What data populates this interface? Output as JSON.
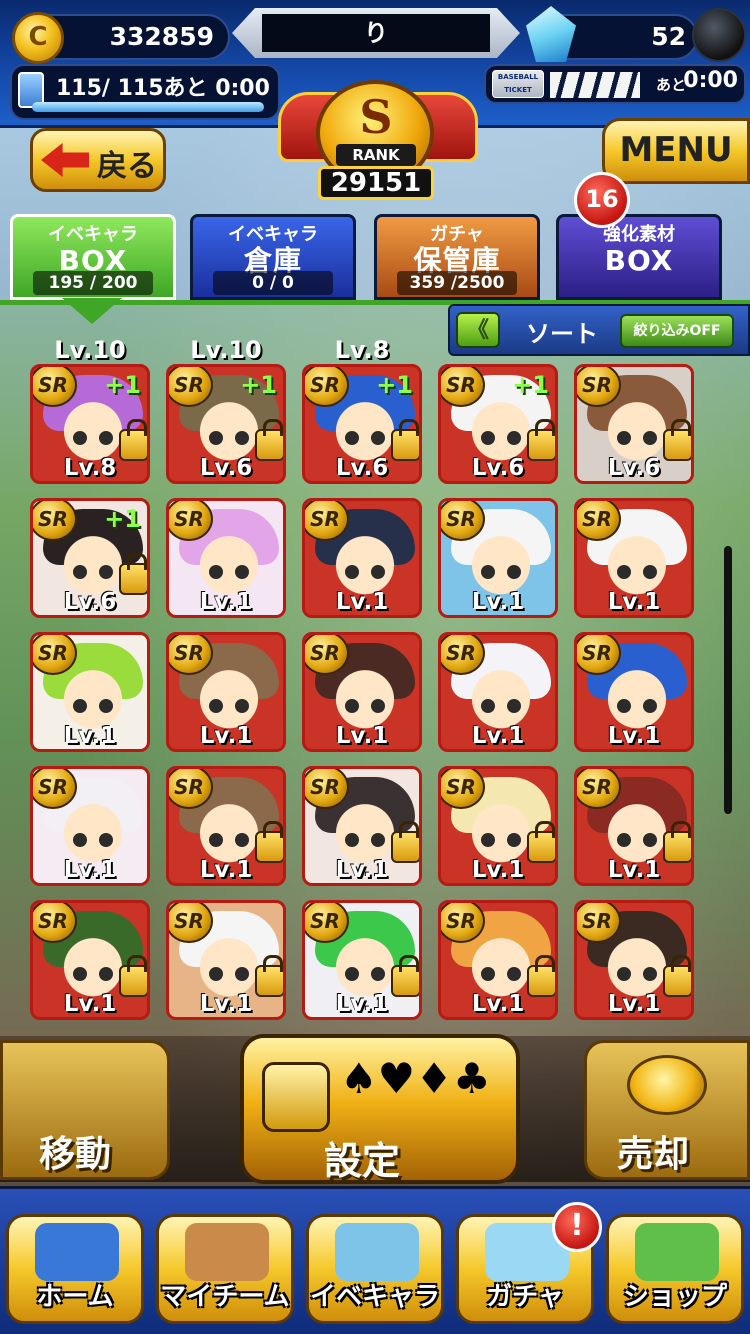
{
  "status": {
    "coins": "332859",
    "coin_icon": "C",
    "player_name": "り",
    "gems": "52",
    "stamina_text": "115/ 115あと  0:00",
    "ticket_label": "BASEBALL TICKET",
    "ticket_ato": "あと",
    "ticket_time": "0:00"
  },
  "rank": {
    "letter": "S",
    "label": "RANK",
    "points": "29151"
  },
  "nav_top": {
    "back_label": "戻る",
    "menu_label": "MENU"
  },
  "tabs": [
    {
      "top": "イベキャラ",
      "big": "BOX",
      "count": "195 / 200"
    },
    {
      "top": "イベキャラ",
      "big": "倉庫",
      "count": "0  /  0"
    },
    {
      "top": "ガチャ",
      "big": "保管庫",
      "count": "359 /2500"
    },
    {
      "top": "強化素材",
      "big": "BOX",
      "count": ""
    }
  ],
  "tab_badge": "16",
  "sort": {
    "arrows": "《",
    "label": "ソート",
    "filter": "絞り込みOFF"
  },
  "partial_row": [
    "Lv.10",
    "Lv.10",
    "Lv.8"
  ],
  "cards": [
    {
      "level": "Lv.8",
      "plus": "+1",
      "locked": true,
      "hair": "#b66ad8",
      "bg": "#c93426"
    },
    {
      "level": "Lv.6",
      "plus": "+1",
      "locked": true,
      "hair": "#7a6a4a",
      "bg": "#c93426"
    },
    {
      "level": "Lv.6",
      "plus": "+1",
      "locked": true,
      "hair": "#2a5fd0",
      "bg": "#c93426"
    },
    {
      "level": "Lv.6",
      "plus": "+1",
      "locked": true,
      "hair": "#f4f4f4",
      "bg": "#c93426"
    },
    {
      "level": "Lv.6",
      "plus": "",
      "locked": true,
      "hair": "#8a5a3c",
      "bg": "#d8d0c8"
    },
    {
      "level": "Lv.6",
      "plus": "+1",
      "locked": true,
      "hair": "#2a2222",
      "bg": "#f2e6e0"
    },
    {
      "level": "Lv.1",
      "plus": "",
      "locked": false,
      "hair": "#e2a6e8",
      "bg": "#f4e6f2"
    },
    {
      "level": "Lv.1",
      "plus": "",
      "locked": false,
      "hair": "#27304a",
      "bg": "#c93426"
    },
    {
      "level": "Lv.1",
      "plus": "",
      "locked": false,
      "hair": "#f5f5f5",
      "bg": "#7ec4e8"
    },
    {
      "level": "Lv.1",
      "plus": "",
      "locked": false,
      "hair": "#f5f5f5",
      "bg": "#c93426"
    },
    {
      "level": "Lv.1",
      "plus": "",
      "locked": false,
      "hair": "#9adc3c",
      "bg": "#f4f0e8"
    },
    {
      "level": "Lv.1",
      "plus": "",
      "locked": false,
      "hair": "#8a6a4a",
      "bg": "#c93426"
    },
    {
      "level": "Lv.1",
      "plus": "",
      "locked": false,
      "hair": "#4a2a22",
      "bg": "#c93426"
    },
    {
      "level": "Lv.1",
      "plus": "",
      "locked": false,
      "hair": "#f4f4f8",
      "bg": "#c93426"
    },
    {
      "level": "Lv.1",
      "plus": "",
      "locked": false,
      "hair": "#2a5fd0",
      "bg": "#c93426"
    },
    {
      "level": "Lv.1",
      "plus": "",
      "locked": false,
      "hair": "#f2f0f4",
      "bg": "#f4ecf2"
    },
    {
      "level": "Lv.1",
      "plus": "",
      "locked": true,
      "hair": "#8a6a4a",
      "bg": "#c93426"
    },
    {
      "level": "Lv.1",
      "plus": "",
      "locked": true,
      "hair": "#3a3232",
      "bg": "#f2e6e0"
    },
    {
      "level": "Lv.1",
      "plus": "",
      "locked": true,
      "hair": "#f4e8b0",
      "bg": "#c93426"
    },
    {
      "level": "Lv.1",
      "plus": "",
      "locked": true,
      "hair": "#8a2a22",
      "bg": "#c93426"
    },
    {
      "level": "Lv.1",
      "plus": "",
      "locked": true,
      "hair": "#3a6a2a",
      "bg": "#c93426"
    },
    {
      "level": "Lv.1",
      "plus": "",
      "locked": true,
      "hair": "#f5f5f5",
      "bg": "#e6b486"
    },
    {
      "level": "Lv.1",
      "plus": "",
      "locked": true,
      "hair": "#3cc84a",
      "bg": "#f0f0f4"
    },
    {
      "level": "Lv.1",
      "plus": "",
      "locked": true,
      "hair": "#f0a444",
      "bg": "#c93426"
    },
    {
      "level": "Lv.1",
      "plus": "",
      "locked": true,
      "hair": "#3a2a22",
      "bg": "#c93426"
    }
  ],
  "card_rarity": "SR",
  "actions": {
    "move": "移動",
    "set": "設定",
    "sell": "売却",
    "suits": "♠♥♦♣"
  },
  "bottom_nav": [
    {
      "label": "ホーム",
      "icon": "home-icon",
      "color": "#3a78d8"
    },
    {
      "label": "マイチーム",
      "icon": "team-icon",
      "color": "#c98a4a"
    },
    {
      "label": "イベキャラ",
      "icon": "event-chara-icon",
      "color": "#7ec4e8"
    },
    {
      "label": "ガチャ",
      "icon": "gacha-icon",
      "color": "#9ad8f4"
    },
    {
      "label": "ショップ",
      "icon": "shop-icon",
      "color": "#5fbf4a"
    }
  ],
  "nav_alert": "!"
}
